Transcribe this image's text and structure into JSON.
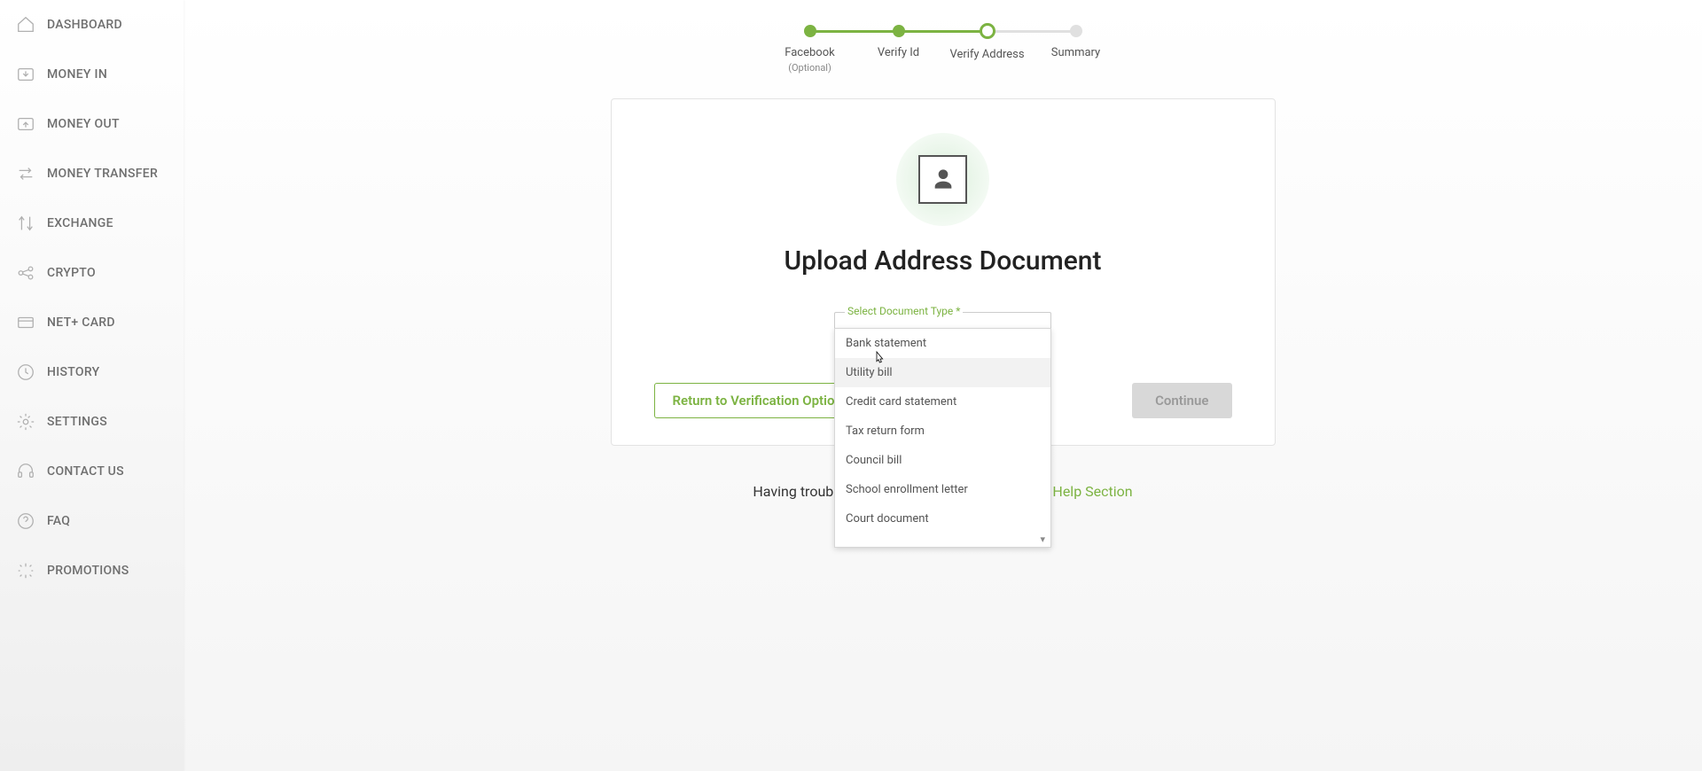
{
  "sidebar": {
    "items": [
      {
        "label": "DASHBOARD",
        "icon": "home"
      },
      {
        "label": "MONEY IN",
        "icon": "in"
      },
      {
        "label": "MONEY OUT",
        "icon": "out"
      },
      {
        "label": "MONEY TRANSFER",
        "icon": "transfer"
      },
      {
        "label": "EXCHANGE",
        "icon": "exchange"
      },
      {
        "label": "CRYPTO",
        "icon": "crypto"
      },
      {
        "label": "NET+ CARD",
        "icon": "card"
      },
      {
        "label": "HISTORY",
        "icon": "history"
      },
      {
        "label": "SETTINGS",
        "icon": "settings"
      },
      {
        "label": "CONTACT US",
        "icon": "contact"
      },
      {
        "label": "FAQ",
        "icon": "faq"
      },
      {
        "label": "PROMOTIONS",
        "icon": "promo"
      }
    ]
  },
  "stepper": [
    {
      "label": "Facebook",
      "sublabel": "(Optional)",
      "state": "done"
    },
    {
      "label": "Verify Id",
      "sublabel": "",
      "state": "done"
    },
    {
      "label": "Verify Address",
      "sublabel": "",
      "state": "current"
    },
    {
      "label": "Summary",
      "sublabel": "",
      "state": "pending"
    }
  ],
  "card": {
    "title": "Upload Address Document",
    "select_label": "Select Document Type *",
    "options": [
      "Bank statement",
      "Utility bill",
      "Credit card statement",
      "Tax return form",
      "Council bill",
      "School enrollment letter",
      "Court document"
    ],
    "return_label": "Return to Verification Options",
    "continue_label": "Continue"
  },
  "help": {
    "prefix": "Having trouble",
    "suffix_hidden": " …r ",
    "link": "Help Section"
  }
}
